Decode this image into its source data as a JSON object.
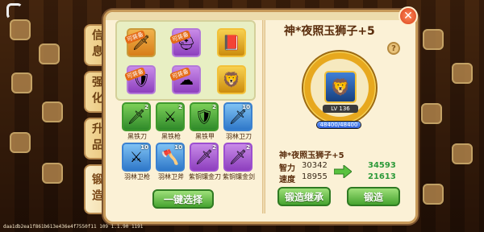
{
  "tabs": [
    {
      "label": "信息"
    },
    {
      "label": "强化"
    },
    {
      "label": "升品"
    },
    {
      "label": "锻造"
    }
  ],
  "equipment_slots": [
    {
      "icon": "sword-icon",
      "badge": "可装备",
      "rarity": "orange"
    },
    {
      "icon": "helmet-icon",
      "badge": "可装备",
      "rarity": "purple"
    },
    {
      "icon": "book-icon",
      "badge": "",
      "rarity": "gold"
    },
    {
      "icon": "armor-icon",
      "badge": "可装备",
      "rarity": "purple"
    },
    {
      "icon": "cloud-icon",
      "badge": "可装备",
      "rarity": "purple"
    },
    {
      "icon": "lion-icon",
      "badge": "",
      "rarity": "gold"
    }
  ],
  "materials": [
    {
      "name": "黑铁刀",
      "count": "2",
      "rarity": "green",
      "icon": "sword-icon"
    },
    {
      "name": "黑铁枪",
      "count": "2",
      "rarity": "green",
      "icon": "spear-icon"
    },
    {
      "name": "黑铁甲",
      "count": "2",
      "rarity": "green",
      "icon": "armor-icon"
    },
    {
      "name": "羽林卫刀",
      "count": "10",
      "rarity": "blue",
      "icon": "sword-icon"
    },
    {
      "name": "羽林卫枪",
      "count": "10",
      "rarity": "blue",
      "icon": "spear-icon"
    },
    {
      "name": "羽林卫斧",
      "count": "10",
      "rarity": "blue",
      "icon": "axe-icon"
    },
    {
      "name": "紫铜镶金刀",
      "count": "2",
      "rarity": "purple",
      "icon": "sword-icon"
    },
    {
      "name": "紫铜镶金剑",
      "count": "2",
      "rarity": "purple",
      "icon": "sword-icon"
    }
  ],
  "auto_select_label": "一键选择",
  "item": {
    "title": "神*夜照玉狮子+5",
    "level": "LV 136",
    "hp_text": "48400/48400",
    "hp_fraction": 1.0,
    "bottom_name": "神*夜照玉狮子+5",
    "stats": [
      {
        "label": "智力",
        "current": "30342",
        "next": "34593"
      },
      {
        "label": "速度",
        "current": "18955",
        "next": "21613"
      }
    ]
  },
  "buttons": {
    "inherit": "锻造继承",
    "forge": "锻造"
  },
  "help_label": "?",
  "footer_text": "daa1db2ea1f861b613e436e4f7550f11 109 1.1.90 1191",
  "colors": {
    "panel": "#fbf1d6",
    "border": "#c79a5a",
    "button_green": "#46a32f",
    "stat_green": "#2d9a3a",
    "ring_gold": "#e7a81e"
  }
}
